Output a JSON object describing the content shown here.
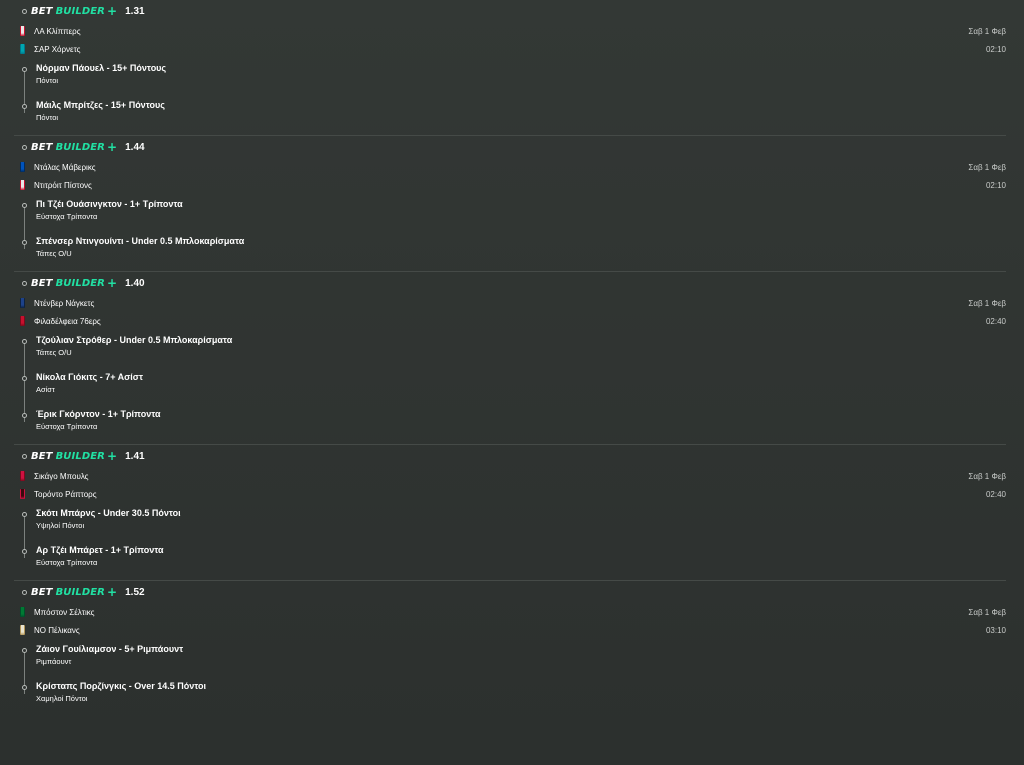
{
  "brand": {
    "bet": "BET",
    "builder": "BUILDER",
    "plus": "+"
  },
  "colors": {
    "accent": "#21e0a3",
    "background": "#303432",
    "divider": "#454a47"
  },
  "bets": [
    {
      "odds": "1.31",
      "date": "Σαβ 1 Φεβ",
      "time": "02:10",
      "teams": [
        {
          "name": "ΛΑ Κλίππερς",
          "jersey": "#e8e8e8",
          "jersey_trim": "#c8102e"
        },
        {
          "name": "ΣΑΡ Χόρνετς",
          "jersey": "#00a6b0",
          "jersey_trim": "#00788c"
        }
      ],
      "selections": [
        {
          "title": "Νόρμαν Πάουελ - 15+ Πόντους",
          "market": "Πόντοι"
        },
        {
          "title": "Μάιλς Μπρίτζες - 15+ Πόντους",
          "market": "Πόντοι"
        }
      ]
    },
    {
      "odds": "1.44",
      "date": "Σαβ 1 Φεβ",
      "time": "02:10",
      "teams": [
        {
          "name": "Ντάλας Μάβερικς",
          "jersey": "#0053bc",
          "jersey_trim": "#002b5e"
        },
        {
          "name": "Ντιτρόιτ Πίστονς",
          "jersey": "#e8e8e8",
          "jersey_trim": "#c8102e"
        }
      ],
      "selections": [
        {
          "title": "Πι Τζέι Ουάσινγκτον - 1+ Τρίποντα",
          "market": "Εύστοχα Τρίποντα"
        },
        {
          "title": "Σπένσερ Ντινγουίντι - Under 0.5 Μπλοκαρίσματα",
          "market": "Τάπες O/U"
        }
      ]
    },
    {
      "odds": "1.40",
      "date": "Σαβ 1 Φεβ",
      "time": "02:40",
      "teams": [
        {
          "name": "Ντένβερ Νάγκετς",
          "jersey": "#1d428a",
          "jersey_trim": "#0e2240"
        },
        {
          "name": "Φιλαδέλφεια 76ερς",
          "jersey": "#c8102e",
          "jersey_trim": "#7a0a1c"
        }
      ],
      "selections": [
        {
          "title": "Τζούλιαν Στρόθερ - Under 0.5 Μπλοκαρίσματα",
          "market": "Τάπες O/U"
        },
        {
          "title": "Νίκολα Γιόκιτς - 7+ Ασίστ",
          "market": "Ασίστ"
        },
        {
          "title": "Έρικ Γκόρντον - 1+ Τρίποντα",
          "market": "Εύστοχα Τρίποντα"
        }
      ]
    },
    {
      "odds": "1.41",
      "date": "Σαβ 1 Φεβ",
      "time": "02:40",
      "teams": [
        {
          "name": "Σικάγο Μπουλς",
          "jersey": "#ce1141",
          "jersey_trim": "#7a0a1c"
        },
        {
          "name": "Τορόντο Ράπτορς",
          "jersey": "#3a0a0e",
          "jersey_trim": "#ce1141"
        }
      ],
      "selections": [
        {
          "title": "Σκότι Μπάρνς - Under 30.5 Πόντοι",
          "market": "Υψηλοί Πόντοι"
        },
        {
          "title": "Αρ Τζέι Μπάρετ - 1+ Τρίποντα",
          "market": "Εύστοχα Τρίποντα"
        }
      ]
    },
    {
      "odds": "1.52",
      "date": "Σαβ 1 Φεβ",
      "time": "03:10",
      "teams": [
        {
          "name": "Μπόστον Σέλτικς",
          "jersey": "#007a33",
          "jersey_trim": "#00502a"
        },
        {
          "name": "ΝΟ Πέλικανς",
          "jersey": "#e8e4d0",
          "jersey_trim": "#b4975a"
        }
      ],
      "selections": [
        {
          "title": "Ζάιον Γουίλιαμσον - 5+ Ριμπάουντ",
          "market": "Ριμπάουντ"
        },
        {
          "title": "Κρίσταπς Πορζίνγκις - Over 14.5 Πόντοι",
          "market": "Χαμηλοί Πόντοι"
        }
      ]
    }
  ]
}
